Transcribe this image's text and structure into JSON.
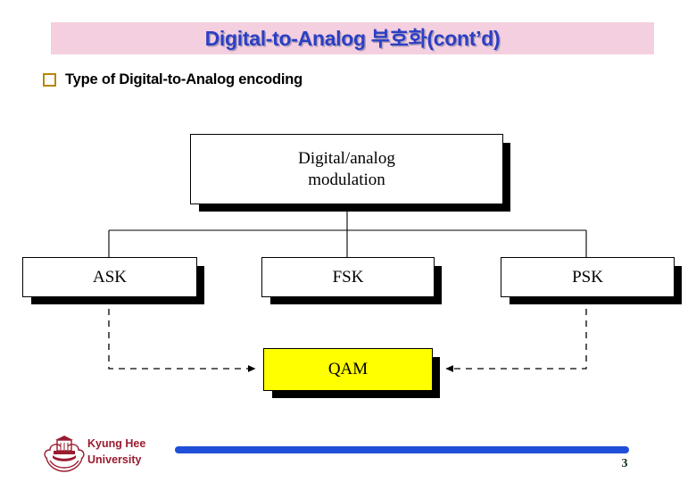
{
  "slide": {
    "title": "Digital-to-Analog 부호화(cont’d)",
    "title_band_color": "#f4cfdf",
    "title_color": "#2b3fc4",
    "bullet_text": "Type of Digital-to-Analog encoding",
    "bullet_marker_color": "#b8860b"
  },
  "diagram": {
    "type": "flowchart",
    "root": {
      "label": "Digital/analog\nmodulation"
    },
    "children": [
      {
        "id": "ask",
        "label": "ASK"
      },
      {
        "id": "fsk",
        "label": "FSK"
      },
      {
        "id": "psk",
        "label": "PSK"
      }
    ],
    "combined": {
      "id": "qam",
      "label": "QAM",
      "fill": "#ffff00"
    },
    "edges": [
      {
        "from": "root",
        "to": "ask",
        "style": "solid"
      },
      {
        "from": "root",
        "to": "fsk",
        "style": "solid"
      },
      {
        "from": "root",
        "to": "psk",
        "style": "solid"
      },
      {
        "from": "ask",
        "to": "qam",
        "style": "dashed",
        "arrow": true
      },
      {
        "from": "psk",
        "to": "qam",
        "style": "dashed",
        "arrow": true
      }
    ]
  },
  "footer": {
    "university": "Kyung Hee\nUniversity",
    "university_color": "#9b1b30",
    "bar_color": "#1f4fd8",
    "page_number": "3"
  }
}
